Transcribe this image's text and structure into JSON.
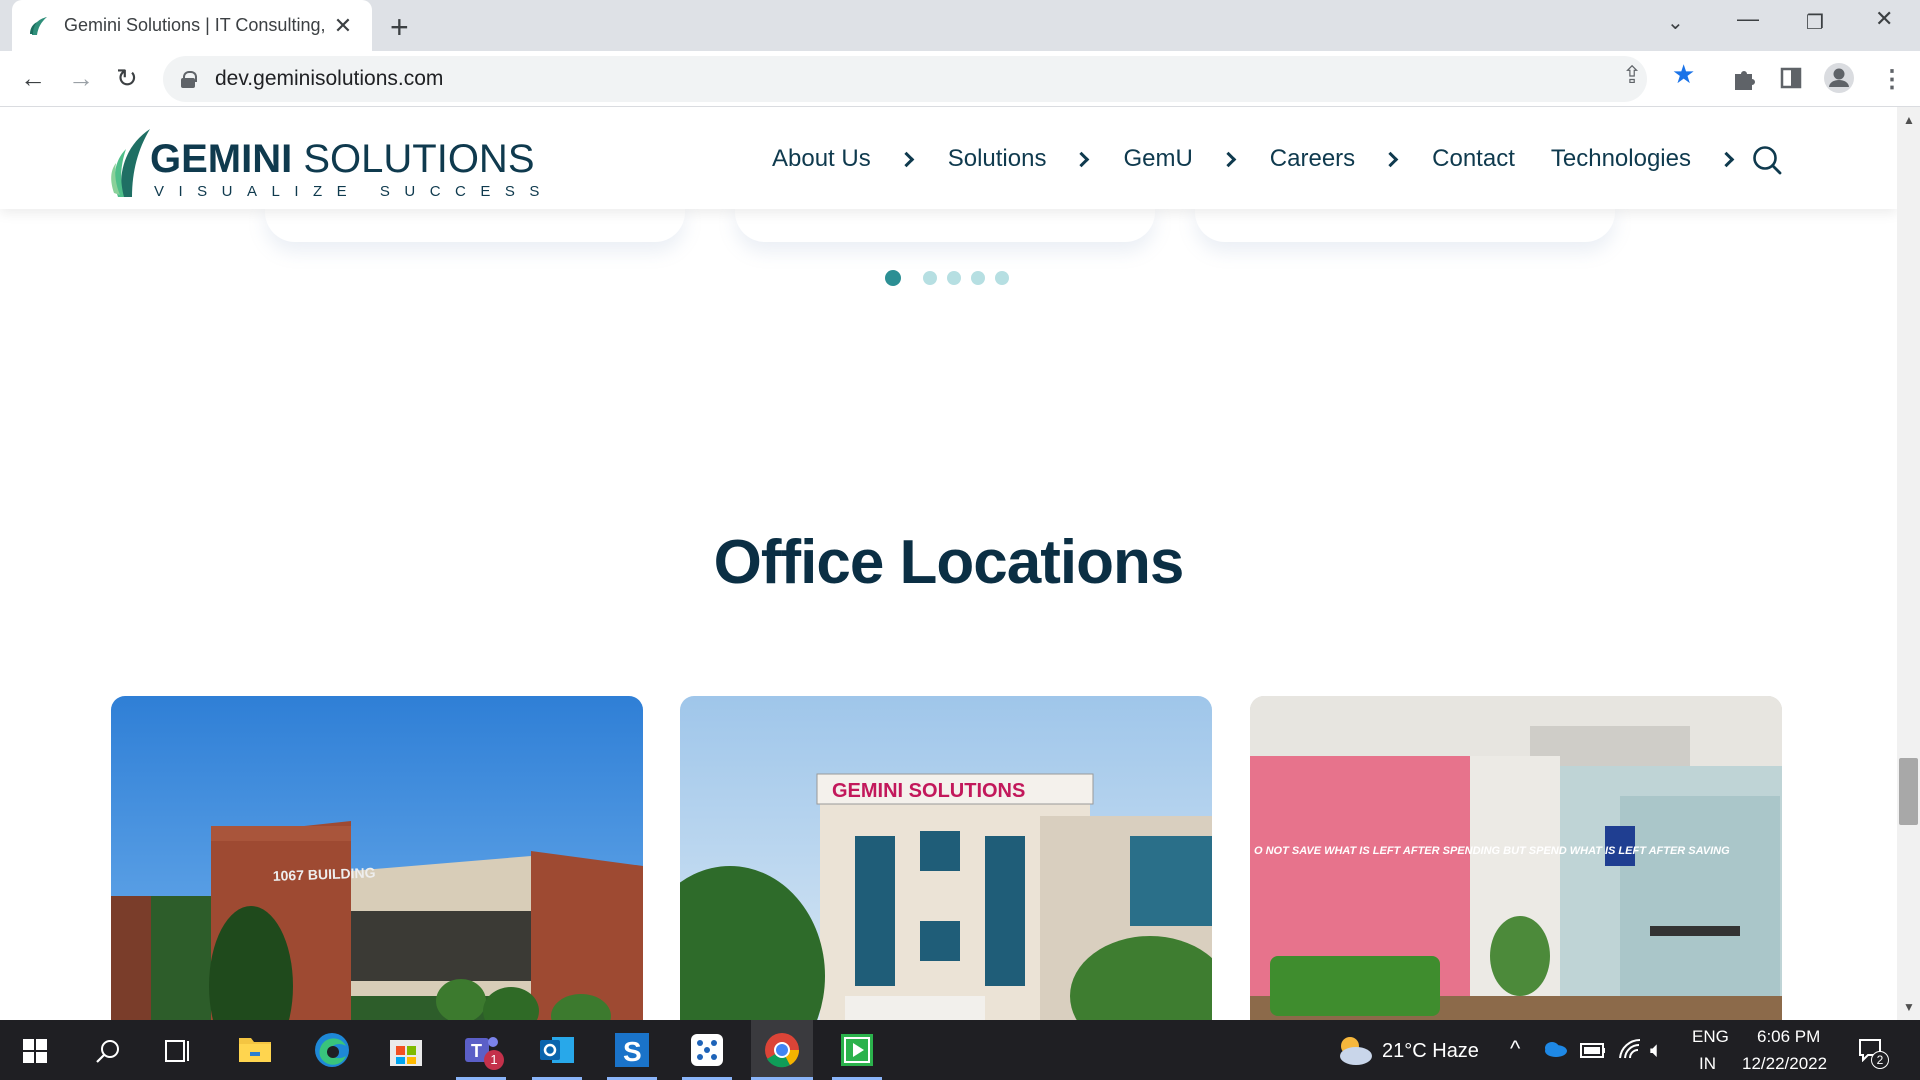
{
  "browser": {
    "tab_title": "Gemini Solutions | IT Consulting,",
    "url": "dev.geminisolutions.com"
  },
  "site": {
    "logo": {
      "name_bold": "GEMINI",
      "name_light": " SOLUTIONS",
      "tagline": "VISUALIZE SUCCESS"
    },
    "nav": [
      {
        "label": "About Us",
        "has_submenu": true
      },
      {
        "label": "Solutions",
        "has_submenu": true
      },
      {
        "label": "GemU",
        "has_submenu": true
      },
      {
        "label": "Careers",
        "has_submenu": true
      },
      {
        "label": "Contact",
        "has_submenu": false
      },
      {
        "label": "Technologies",
        "has_submenu": true
      }
    ],
    "carousel": {
      "slide_count": 5,
      "active_index": 0
    },
    "section_title": "Office Locations",
    "location_cards": [
      {
        "image_text": "1067 BUILDING"
      },
      {
        "image_text": "GEMINI SOLUTIONS"
      },
      {
        "image_text": "O NOT SAVE WHAT IS LEFT AFTER SPENDING BUT SPEND WHAT IS LEFT AFTER SAVING"
      }
    ],
    "colors": {
      "brand_navy": "#0f3a4e",
      "accent_teal": "#2c8f94",
      "dot_inactive": "#b6dfe2"
    }
  },
  "taskbar": {
    "weather": "21°C  Haze",
    "language_line1": "ENG",
    "language_line2": "IN",
    "time": "6:06 PM",
    "date": "12/22/2022",
    "notification_count": "2",
    "teams_badge": "1",
    "apps": [
      "windows-start-icon",
      "search-icon",
      "task-view-icon",
      "file-explorer-icon",
      "edge-icon",
      "store-icon",
      "teams-icon",
      "outlook-icon",
      "app-s-icon",
      "app-cube-icon",
      "chrome-icon",
      "app-play-icon"
    ]
  }
}
